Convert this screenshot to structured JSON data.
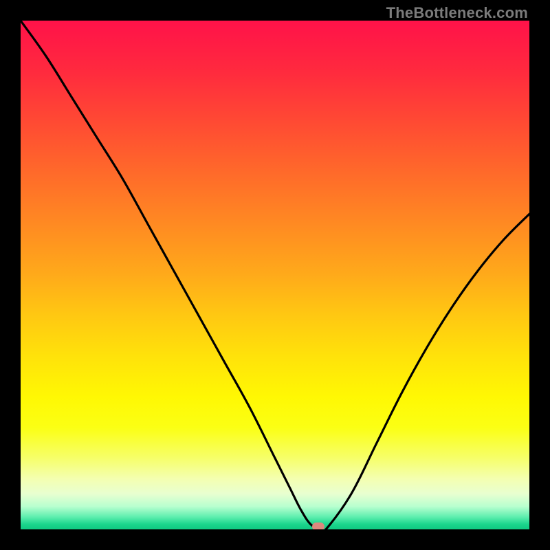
{
  "watermark_text": "TheBottleneck.com",
  "marker_color": "#db8a7e",
  "curve_color": "#000000",
  "gradient_stops": [
    {
      "pos": 0.0,
      "color": "#ff1249"
    },
    {
      "pos": 0.1,
      "color": "#ff2a3e"
    },
    {
      "pos": 0.2,
      "color": "#ff4a33"
    },
    {
      "pos": 0.3,
      "color": "#ff6a2a"
    },
    {
      "pos": 0.4,
      "color": "#ff8a22"
    },
    {
      "pos": 0.5,
      "color": "#ffaa1a"
    },
    {
      "pos": 0.58,
      "color": "#ffc812"
    },
    {
      "pos": 0.66,
      "color": "#ffe20a"
    },
    {
      "pos": 0.74,
      "color": "#fff803"
    },
    {
      "pos": 0.8,
      "color": "#fbff14"
    },
    {
      "pos": 0.86,
      "color": "#f6ff6a"
    },
    {
      "pos": 0.9,
      "color": "#f4ffb0"
    },
    {
      "pos": 0.93,
      "color": "#e8ffd0"
    },
    {
      "pos": 0.955,
      "color": "#b8ffcf"
    },
    {
      "pos": 0.975,
      "color": "#60efb0"
    },
    {
      "pos": 0.99,
      "color": "#1bd58c"
    },
    {
      "pos": 1.0,
      "color": "#10c982"
    }
  ],
  "chart_data": {
    "type": "line",
    "title": "",
    "xlabel": "",
    "ylabel": "",
    "xlim": [
      0,
      100
    ],
    "ylim": [
      0,
      100
    ],
    "grid": false,
    "series": [
      {
        "name": "bottleneck-curve",
        "x": [
          0,
          5,
          10,
          15,
          20,
          25,
          30,
          35,
          40,
          45,
          50,
          53,
          55,
          57,
          59,
          60,
          65,
          70,
          75,
          80,
          85,
          90,
          95,
          100
        ],
        "y": [
          100,
          93,
          85,
          77,
          69,
          60,
          51,
          42,
          33,
          24,
          14,
          8,
          4,
          1,
          0,
          0,
          7,
          17,
          27,
          36,
          44,
          51,
          57,
          62
        ]
      }
    ],
    "annotations": [
      {
        "type": "marker",
        "name": "minimum",
        "x": 58.5,
        "y": 0.5
      }
    ]
  }
}
